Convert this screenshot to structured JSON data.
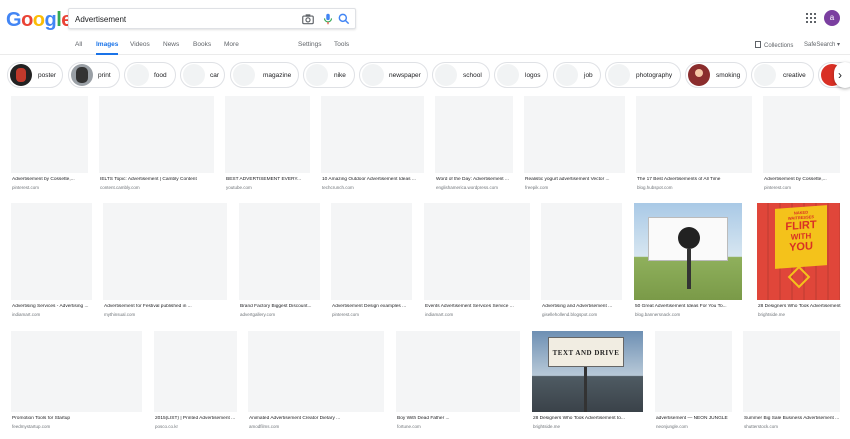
{
  "logo": {
    "letters": [
      "G",
      "o",
      "o",
      "g",
      "l",
      "e"
    ],
    "colors": [
      "#4285f4",
      "#ea4335",
      "#fbbc05",
      "#4285f4",
      "#34a853",
      "#ea4335"
    ]
  },
  "search": {
    "value": "Advertisement"
  },
  "user": {
    "initial": "a",
    "color": "#7b3fa0"
  },
  "tabs": [
    {
      "label": "All"
    },
    {
      "label": "Images",
      "active": true
    },
    {
      "label": "Videos"
    },
    {
      "label": "News"
    },
    {
      "label": "Books"
    },
    {
      "label": "More"
    }
  ],
  "tools": {
    "settings": "Settings",
    "tools": "Tools",
    "collections": "Collections",
    "safesearch": "SafeSearch"
  },
  "chips": [
    {
      "label": "poster"
    },
    {
      "label": "print"
    },
    {
      "label": "food"
    },
    {
      "label": "car"
    },
    {
      "label": "magazine"
    },
    {
      "label": "nike"
    },
    {
      "label": "newspaper"
    },
    {
      "label": "school"
    },
    {
      "label": "logos"
    },
    {
      "label": "job"
    },
    {
      "label": "photography"
    },
    {
      "label": "smoking"
    },
    {
      "label": "creative"
    }
  ],
  "results": [
    {
      "caption": "Advertisement by Cossette,...",
      "source": "pinterest.com"
    },
    {
      "caption": "IELTS Topic: Advertisement | Cambly Content",
      "source": "content.cambly.com"
    },
    {
      "caption": "BEST ADVERTISEMENT EVERY...",
      "source": "youtube.com"
    },
    {
      "caption": "10 Amazing Outdoor Advertisement Ideas ...",
      "source": "techcrunch.com"
    },
    {
      "caption": "Word of the Day: Advertisement ...",
      "source": "englishamerica.wordpress.com"
    },
    {
      "caption": "Realistic yogurt advertisement Vector ...",
      "source": "freepik.com"
    },
    {
      "caption": "The 17 Best Advertisements of All Time",
      "source": "blog.hubspot.com"
    },
    {
      "caption": "Advertisement by Cossette,...",
      "source": "pinterest.com"
    },
    {
      "caption": "Advertising Services - Advertising ...",
      "source": "indiamart.com"
    },
    {
      "caption": "Advertisement for Festival published in ...",
      "source": "mythinsual.com"
    },
    {
      "caption": "Brand Factory Biggest Discount...",
      "source": "advertgallery.com"
    },
    {
      "caption": "Advertisement Design examples ...",
      "source": "pinterest.com"
    },
    {
      "caption": "Events Advertisement Services Service ...",
      "source": "indiamart.com"
    },
    {
      "caption": "Advertising and Advertisement ...",
      "source": "gisellehollend.blogspot.com"
    },
    {
      "caption": "50 Great Advertisement Ideas For You To...",
      "source": "blog.bannersnack.com"
    },
    {
      "caption": "28 Designers Who Took Advertisement...",
      "source": "brightside.me",
      "art": "waiters"
    },
    {
      "caption": "Promotion Tools for Startup",
      "source": "feedmystartup.com"
    },
    {
      "caption": "2015(LIST) | Printed Advertisement ...",
      "source": "posco.co.kr"
    },
    {
      "caption": "Animated Advertisement Creator Dietary ...",
      "source": "amodfilms.com"
    },
    {
      "caption": "Boy With Dead Father ...",
      "source": "fortune.com"
    },
    {
      "caption": "28 Designers Who Took Advertisement to...",
      "source": "brightside.me",
      "art": "text-and-drive"
    },
    {
      "caption": "advertisement — NEON JUNGLE",
      "source": "neonjungle.com"
    },
    {
      "caption": "Summer Big Sale Business Advertisement ...",
      "source": "shutterstock.com"
    }
  ],
  "art_text": {
    "waiters": [
      "NAKED",
      "WAITRESSES",
      "FLIRT",
      "WITH",
      "YOU"
    ],
    "text_and_drive": [
      "TEXT AND DRIVE"
    ]
  }
}
